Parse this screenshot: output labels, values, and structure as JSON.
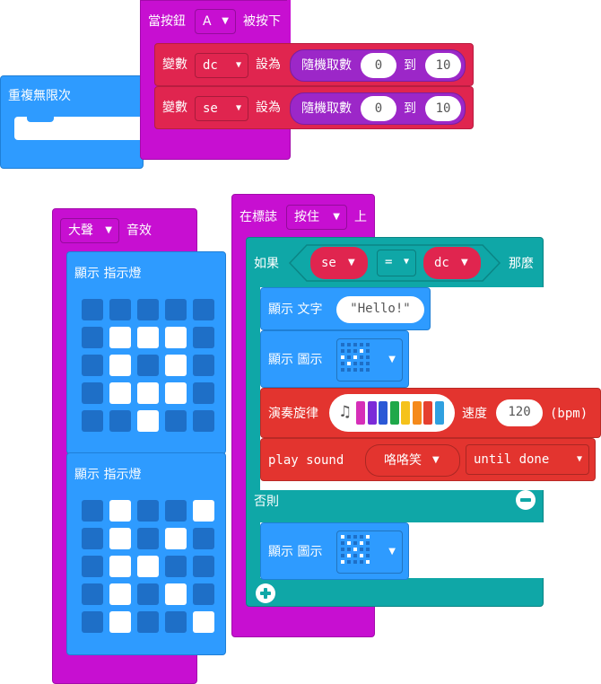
{
  "forever": {
    "label": "重複無限次"
  },
  "on_button": {
    "label_prefix": "當按鈕",
    "button": "A",
    "label_suffix": "被按下",
    "rows": [
      {
        "kw": "變數",
        "var": "dc",
        "set": "設為",
        "func": "隨機取數",
        "from": "0",
        "to_word": "到",
        "to": "10"
      },
      {
        "kw": "變數",
        "var": "se",
        "set": "設為",
        "func": "隨機取數",
        "from": "0",
        "to_word": "到",
        "to": "10"
      }
    ]
  },
  "on_sound": {
    "sound": "大聲",
    "label": "音效",
    "show_leds_1": "顯示 指示燈",
    "show_leds_2": "顯示 指示燈",
    "leds_1": [
      [
        0,
        0,
        0,
        0,
        0
      ],
      [
        0,
        1,
        1,
        1,
        0
      ],
      [
        0,
        1,
        0,
        1,
        0
      ],
      [
        0,
        1,
        1,
        1,
        0
      ],
      [
        0,
        0,
        1,
        0,
        0
      ]
    ],
    "leds_2": [
      [
        0,
        1,
        0,
        0,
        1
      ],
      [
        0,
        1,
        0,
        1,
        0
      ],
      [
        0,
        1,
        1,
        0,
        0
      ],
      [
        0,
        1,
        0,
        1,
        0
      ],
      [
        0,
        1,
        0,
        0,
        1
      ]
    ]
  },
  "on_logo": {
    "label_prefix": "在標誌",
    "gesture": "按住",
    "label_suffix": "上",
    "if_kw": "如果",
    "left": "se",
    "op": "=",
    "right": "dc",
    "then_kw": "那麼",
    "show_string_kw": "顯示 文字",
    "string_value": "\"Hello!\"",
    "show_icon_kw": "顯示 圖示",
    "play_melody_kw": "演奏旋律",
    "tempo_kw": "速度",
    "tempo": "120",
    "bpm": "(bpm)",
    "play_sound_kw": "play sound",
    "sound_choice": "咯咯笑",
    "until_done": "until done",
    "else_kw": "否則",
    "show_icon_kw_2": "顯示 圖示",
    "melody_colors": [
      "#d62fb8",
      "#7b2ad8",
      "#2b58d6",
      "#1fa84a",
      "#f5c21b",
      "#f58a1b",
      "#e53f2f",
      "#2fa0e0"
    ]
  },
  "colors": {
    "event": "#c70fd1",
    "basic": "#2e9bff",
    "variables": "#e0254f",
    "logic": "#0fa7a7",
    "music": "#e3342f",
    "math": "#9c27c8"
  }
}
